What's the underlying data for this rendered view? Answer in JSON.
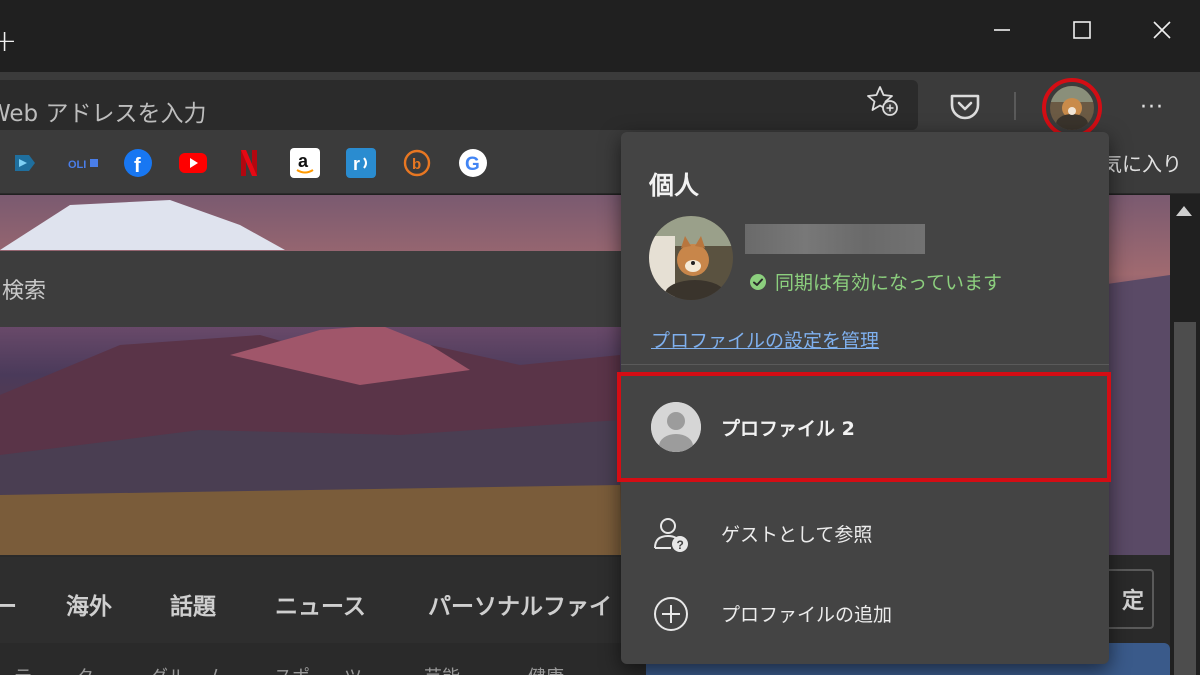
{
  "window": {
    "new_tab_symbol": "+",
    "controls": [
      "minimize",
      "maximize",
      "close"
    ]
  },
  "toolbar": {
    "address_placeholder": "Web アドレスを入力",
    "more_label": "···"
  },
  "favorites": {
    "items": [
      {
        "name": "Pinned site",
        "glyph": "",
        "color": "#2aa6e0"
      },
      {
        "name": "OLI",
        "glyph": "OLI",
        "color": "#3b6fd8"
      },
      {
        "name": "Facebook",
        "glyph": "f",
        "color": "#1877f2"
      },
      {
        "name": "YouTube",
        "glyph": "▶",
        "color": "#ff0000"
      },
      {
        "name": "Netflix",
        "glyph": "N",
        "color": "#e50914"
      },
      {
        "name": "Amazon",
        "glyph": "a",
        "color": "#ffffff"
      },
      {
        "name": "Rakuten Rapid",
        "glyph": "r",
        "color": "#2a8cd0"
      },
      {
        "name": "b",
        "glyph": "b",
        "color": "#e87722"
      },
      {
        "name": "Google",
        "glyph": "G",
        "color": "#ffffff"
      }
    ],
    "other_favorites_label": "気に入り"
  },
  "page": {
    "search_label": "検索",
    "news_tabs": [
      "ー",
      "海外",
      "話題",
      "ニュース",
      "パーソナルファイ"
    ],
    "sub_tabs": [
      "テ",
      "ク",
      "グル",
      "ム",
      "スポ",
      "ツ",
      "芸能",
      "健康"
    ],
    "settings_label": "定"
  },
  "profile_menu": {
    "section_title": "個人",
    "sync_status": "同期は有効になっています",
    "manage_link": "プロファイルの設定を管理",
    "other_profile": "プロファイル 2",
    "guest_label": "ゲストとして参照",
    "add_profile_label": "プロファイルの追加"
  },
  "colors": {
    "highlight": "#d40d14",
    "sync_green": "#8ccf7e",
    "link_blue": "#7fb0ee"
  }
}
